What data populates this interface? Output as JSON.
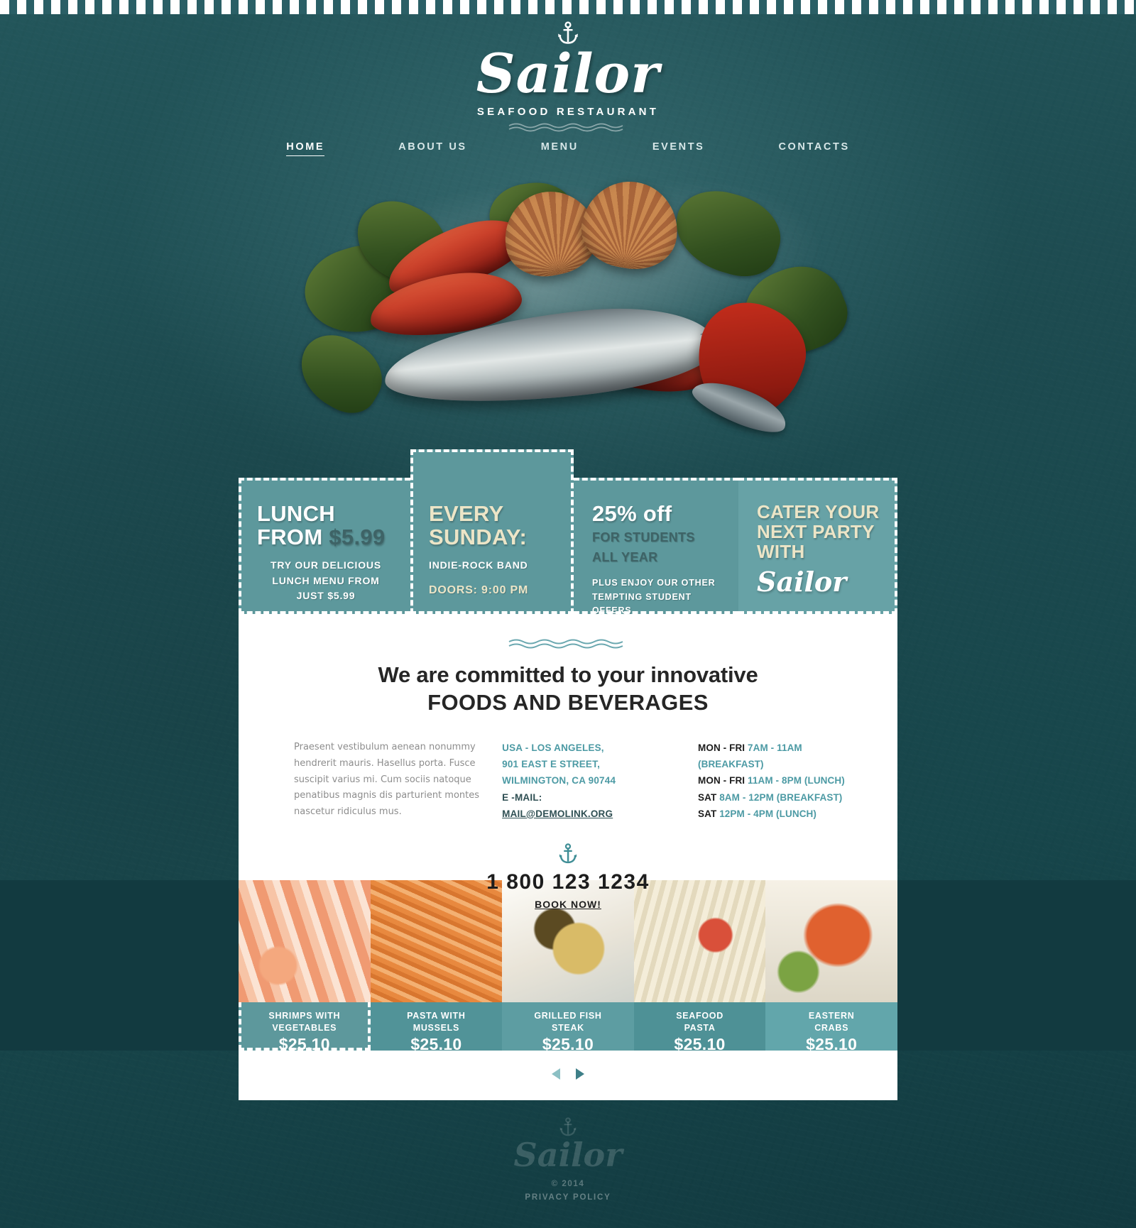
{
  "brand": {
    "name": "Sailor",
    "tagline": "SEAFOOD RESTAURANT",
    "anchor_icon": "anchor-icon"
  },
  "nav": {
    "items": [
      {
        "label": "HOME",
        "active": true
      },
      {
        "label": "ABOUT US",
        "active": false
      },
      {
        "label": "MENU",
        "active": false
      },
      {
        "label": "EVENTS",
        "active": false
      },
      {
        "label": "CONTACTS",
        "active": false
      }
    ]
  },
  "promos": [
    {
      "title_line1": "LUNCH",
      "title_line2": "FROM",
      "price": "$5.99",
      "sub_line1": "TRY OUR DELICIOUS",
      "sub_line2": "LUNCH MENU FROM",
      "sub_line3": "JUST $5.99"
    },
    {
      "title_line1": "EVERY",
      "title_line2": "SUNDAY:",
      "sub_line1": "INDIE-ROCK BAND",
      "sub_line2": "DOORS: 9:00 PM"
    },
    {
      "title_line1": "25% off",
      "title_line2": "FOR STUDENTS",
      "title_line3": "ALL YEAR",
      "sub_line1": "PLUS ENJOY OUR OTHER",
      "sub_line2": "TEMPTING STUDENT",
      "sub_line3": "OFFERS"
    },
    {
      "title_line1": "CATER YOUR",
      "title_line2": "NEXT PARTY",
      "title_line3": "WITH",
      "logo": "Sailor"
    }
  ],
  "content": {
    "headline_1": "We are committed to your innovative",
    "headline_2": "FOODS AND BEVERAGES",
    "about_text": "Praesent vestibulum aenean nonummy hendrerit mauris. Hasellus porta. Fusce suscipit varius mi. Cum sociis natoque penatibus magnis dis parturient montes nascetur ridiculus mus.",
    "address": {
      "line1": "USA - LOS ANGELES,",
      "line2": "901 EAST E STREET,",
      "line3": "WILMINGTON, CA 90744",
      "email_label": "E -MAIL:",
      "email": "MAIL@DEMOLINK.ORG"
    },
    "hours": [
      {
        "day": "MON - FRI",
        "time": "7AM - 11AM (BREAKFAST)"
      },
      {
        "day": "MON - FRI",
        "time": "11AM - 8PM (LUNCH)"
      },
      {
        "day": "SAT",
        "time": "8AM - 12PM (BREAKFAST)"
      },
      {
        "day": "SAT",
        "time": "12PM - 4PM (LUNCH)"
      }
    ],
    "phone": "1 800 123 1234",
    "book_now": "BOOK NOW!"
  },
  "gallery": {
    "dishes": [
      {
        "name_line1": "SHRIMPS WITH",
        "name_line2": "VEGETABLES",
        "price": "$25.10"
      },
      {
        "name_line1": "PASTA WITH",
        "name_line2": "MUSSELS",
        "price": "$25.10"
      },
      {
        "name_line1": "GRILLED FISH",
        "name_line2": "STEAK",
        "price": "$25.10"
      },
      {
        "name_line1": "SEAFOOD",
        "name_line2": "PASTA",
        "price": "$25.10"
      },
      {
        "name_line1": "EASTERN",
        "name_line2": "CRABS",
        "price": "$25.10"
      }
    ],
    "prev_icon": "arrow-left-icon",
    "next_icon": "arrow-right-icon"
  },
  "footer": {
    "logo": "Sailor",
    "copyright": "© 2014",
    "privacy": "PRIVACY POLICY"
  },
  "colors": {
    "background": "#1d4b50",
    "promo_teal": "#5d989c",
    "accent_cream": "#ece5c7",
    "link_teal": "#4c9aa4",
    "dark_teal": "#123a40"
  }
}
